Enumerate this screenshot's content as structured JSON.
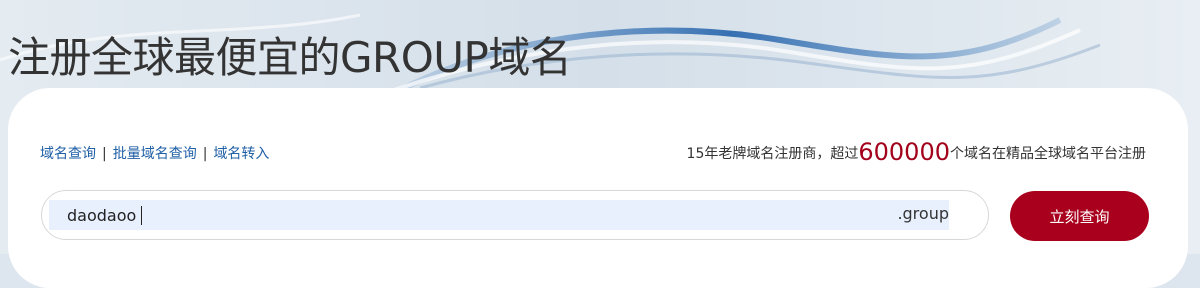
{
  "header": {
    "title": "注册全球最便宜的GROUP域名"
  },
  "nav": {
    "links": [
      "域名查询",
      "批量域名查询",
      "域名转入"
    ],
    "separator": "|"
  },
  "promo": {
    "prefix": "15年老牌域名注册商，超过",
    "count": "600000",
    "suffix": "个域名在精品全球域名平台注册"
  },
  "search": {
    "value": "daodaoo",
    "tld": ".group",
    "button_label": "立刻查询"
  },
  "colors": {
    "accent": "#a8001d",
    "link": "#1f5fa6"
  }
}
